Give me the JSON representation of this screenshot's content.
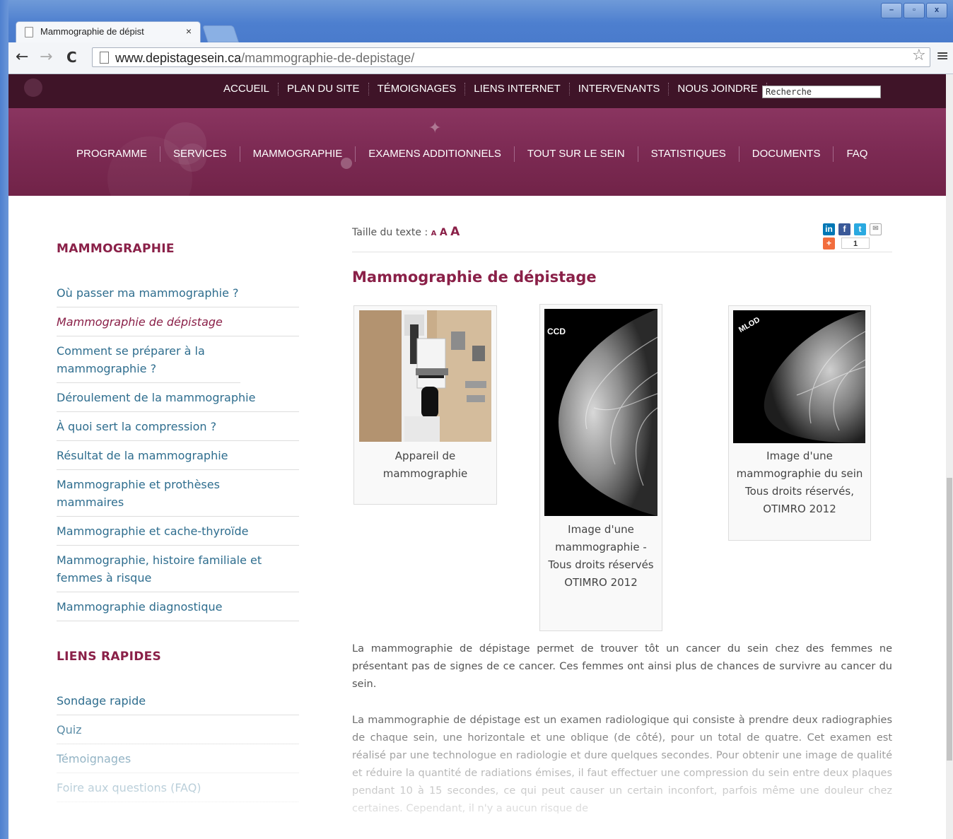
{
  "browser": {
    "tab_title": "Mammographie de dépist",
    "tab_close": "×",
    "url_domain": "www.depistagesein.ca",
    "url_path": "/mammographie-de-depistage/",
    "window_controls": [
      "–",
      "▫",
      "x"
    ]
  },
  "topnav": {
    "items": [
      "ACCUEIL",
      "PLAN DU SITE",
      "TÉMOIGNAGES",
      "LIENS INTERNET",
      "INTERVENANTS",
      "NOUS JOINDRE"
    ],
    "search_placeholder": "Recherche"
  },
  "mainnav": {
    "items": [
      "PROGRAMME",
      "SERVICES",
      "MAMMOGRAPHIE",
      "EXAMENS ADDITIONNELS",
      "TOUT SUR LE SEIN",
      "STATISTIQUES",
      "DOCUMENTS",
      "FAQ"
    ]
  },
  "sidebar": {
    "heading": "MAMMOGRAPHIE",
    "items": [
      "Où passer ma mammographie ?",
      "Mammographie de dépistage",
      "Comment se préparer à la mammographie ?",
      "Déroulement de la mammographie",
      "À quoi sert la compression ?",
      "Résultat de la mammographie",
      "Mammographie et prothèses mammaires",
      "Mammographie et cache-thyroïde",
      "Mammographie, histoire familiale et femmes à risque",
      "Mammographie diagnostique"
    ],
    "quick_heading": "LIENS RAPIDES",
    "quick_items": [
      "Sondage rapide",
      "Quiz",
      "Témoignages",
      "Foire aux questions (FAQ)"
    ]
  },
  "content": {
    "text_size_label": "Taille du texte :",
    "text_size_options": [
      "A",
      "A",
      "A"
    ],
    "share_count": "1",
    "title": "Mammographie de dépistage",
    "figures": [
      {
        "caption": "Appareil de mammographie"
      },
      {
        "caption": "Image d'une mammographie - Tous droits réservés OTIMRO 2012",
        "label": "CCD"
      },
      {
        "caption": "Image d'une mammographie du sein Tous droits réservés, OTIMRO 2012",
        "label": "MLOD"
      }
    ],
    "paragraph1": "La mammographie de dépistage permet de trouver tôt un cancer du sein chez des femmes ne présentant pas de signes de ce cancer. Ces femmes ont ainsi plus de chances de survivre au cancer du sein.",
    "paragraph2": "La mammographie de dépistage est un examen radiologique qui consiste à prendre deux radiographies de chaque sein, une horizontale et une oblique (de côté), pour un total de quatre. Cet examen est réalisé par une technologue en radiologie et dure quelques secondes. Pour obtenir une image de qualité et réduire la quantité de radiations émises, il faut effectuer une compression du sein entre deux plaques pendant 10 à 15 secondes, ce qui peut causer un certain inconfort, parfois même une douleur chez certaines. Cependant, il n'y a aucun risque de"
  },
  "colors": {
    "brand": "#8a2048",
    "link": "#2e6d8e",
    "header_dark": "#3f1428",
    "banner": "#7c2a53"
  }
}
